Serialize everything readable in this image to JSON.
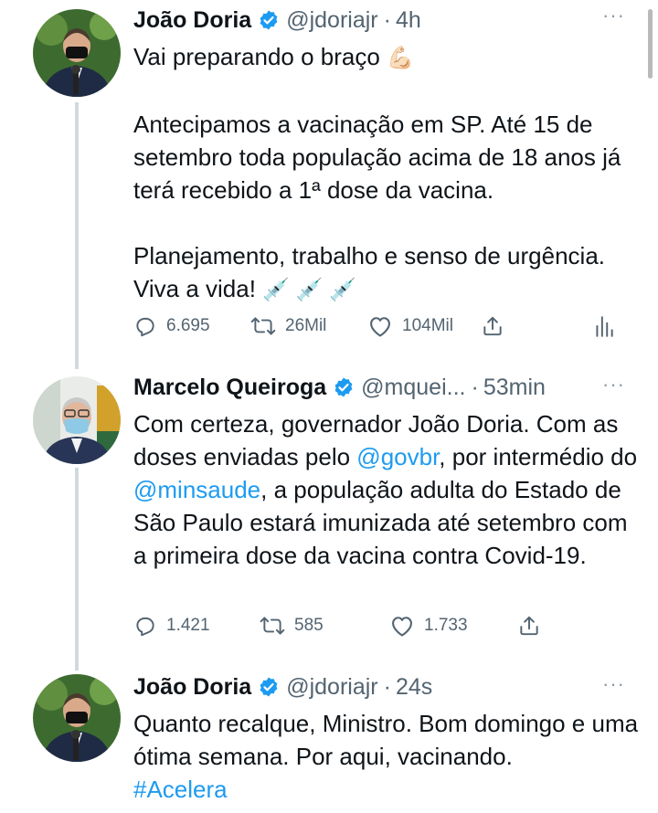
{
  "tweets": [
    {
      "name": "João Doria",
      "handle": "@jdoriajr",
      "time": "4h",
      "more": "···",
      "body": {
        "line1_text": "Vai preparando o braço",
        "line1_emoji": "💪🏻",
        "para2": "Antecipamos a vacinação em SP. Até 15 de setembro toda população acima de 18 anos já terá recebido a 1ª dose da vacina.",
        "para3_text": "Planejamento, trabalho e senso de urgência. Viva a vida!",
        "para3_emoji": "💉 💉 💉"
      },
      "replies": "6.695",
      "retweets": "26Mil",
      "likes": "104Mil"
    },
    {
      "name": "Marcelo Queiroga",
      "handle": "@mquei...",
      "time": "53min",
      "more": "···",
      "body": {
        "t1": "Com certeza, governador João Doria. Com as doses enviadas pelo ",
        "mention1": "@govbr",
        "t2": ", por intermédio do ",
        "mention2": "@minsaude",
        "t3": ", a população adulta do Estado de São Paulo estará imunizada até setembro com a primeira dose da vacina contra Covid-19."
      },
      "replies": "1.421",
      "retweets": "585",
      "likes": "1.733"
    },
    {
      "name": "João Doria",
      "handle": "@jdoriajr",
      "time": "24s",
      "more": "···",
      "body": {
        "text": "Quanto recalque, Ministro. Bom domingo e uma ótima semana. Por aqui, vacinando.",
        "hashtag": "#Acelera"
      }
    }
  ],
  "colors": {
    "text": "#0f1419",
    "secondary": "#536471",
    "link": "#1d9bf0",
    "verified": "#1d9bf0",
    "thread_line": "#cfd9de"
  },
  "icons": [
    "verified-badge-icon",
    "more-icon",
    "reply-icon",
    "retweet-icon",
    "like-icon",
    "share-icon",
    "analytics-icon"
  ]
}
